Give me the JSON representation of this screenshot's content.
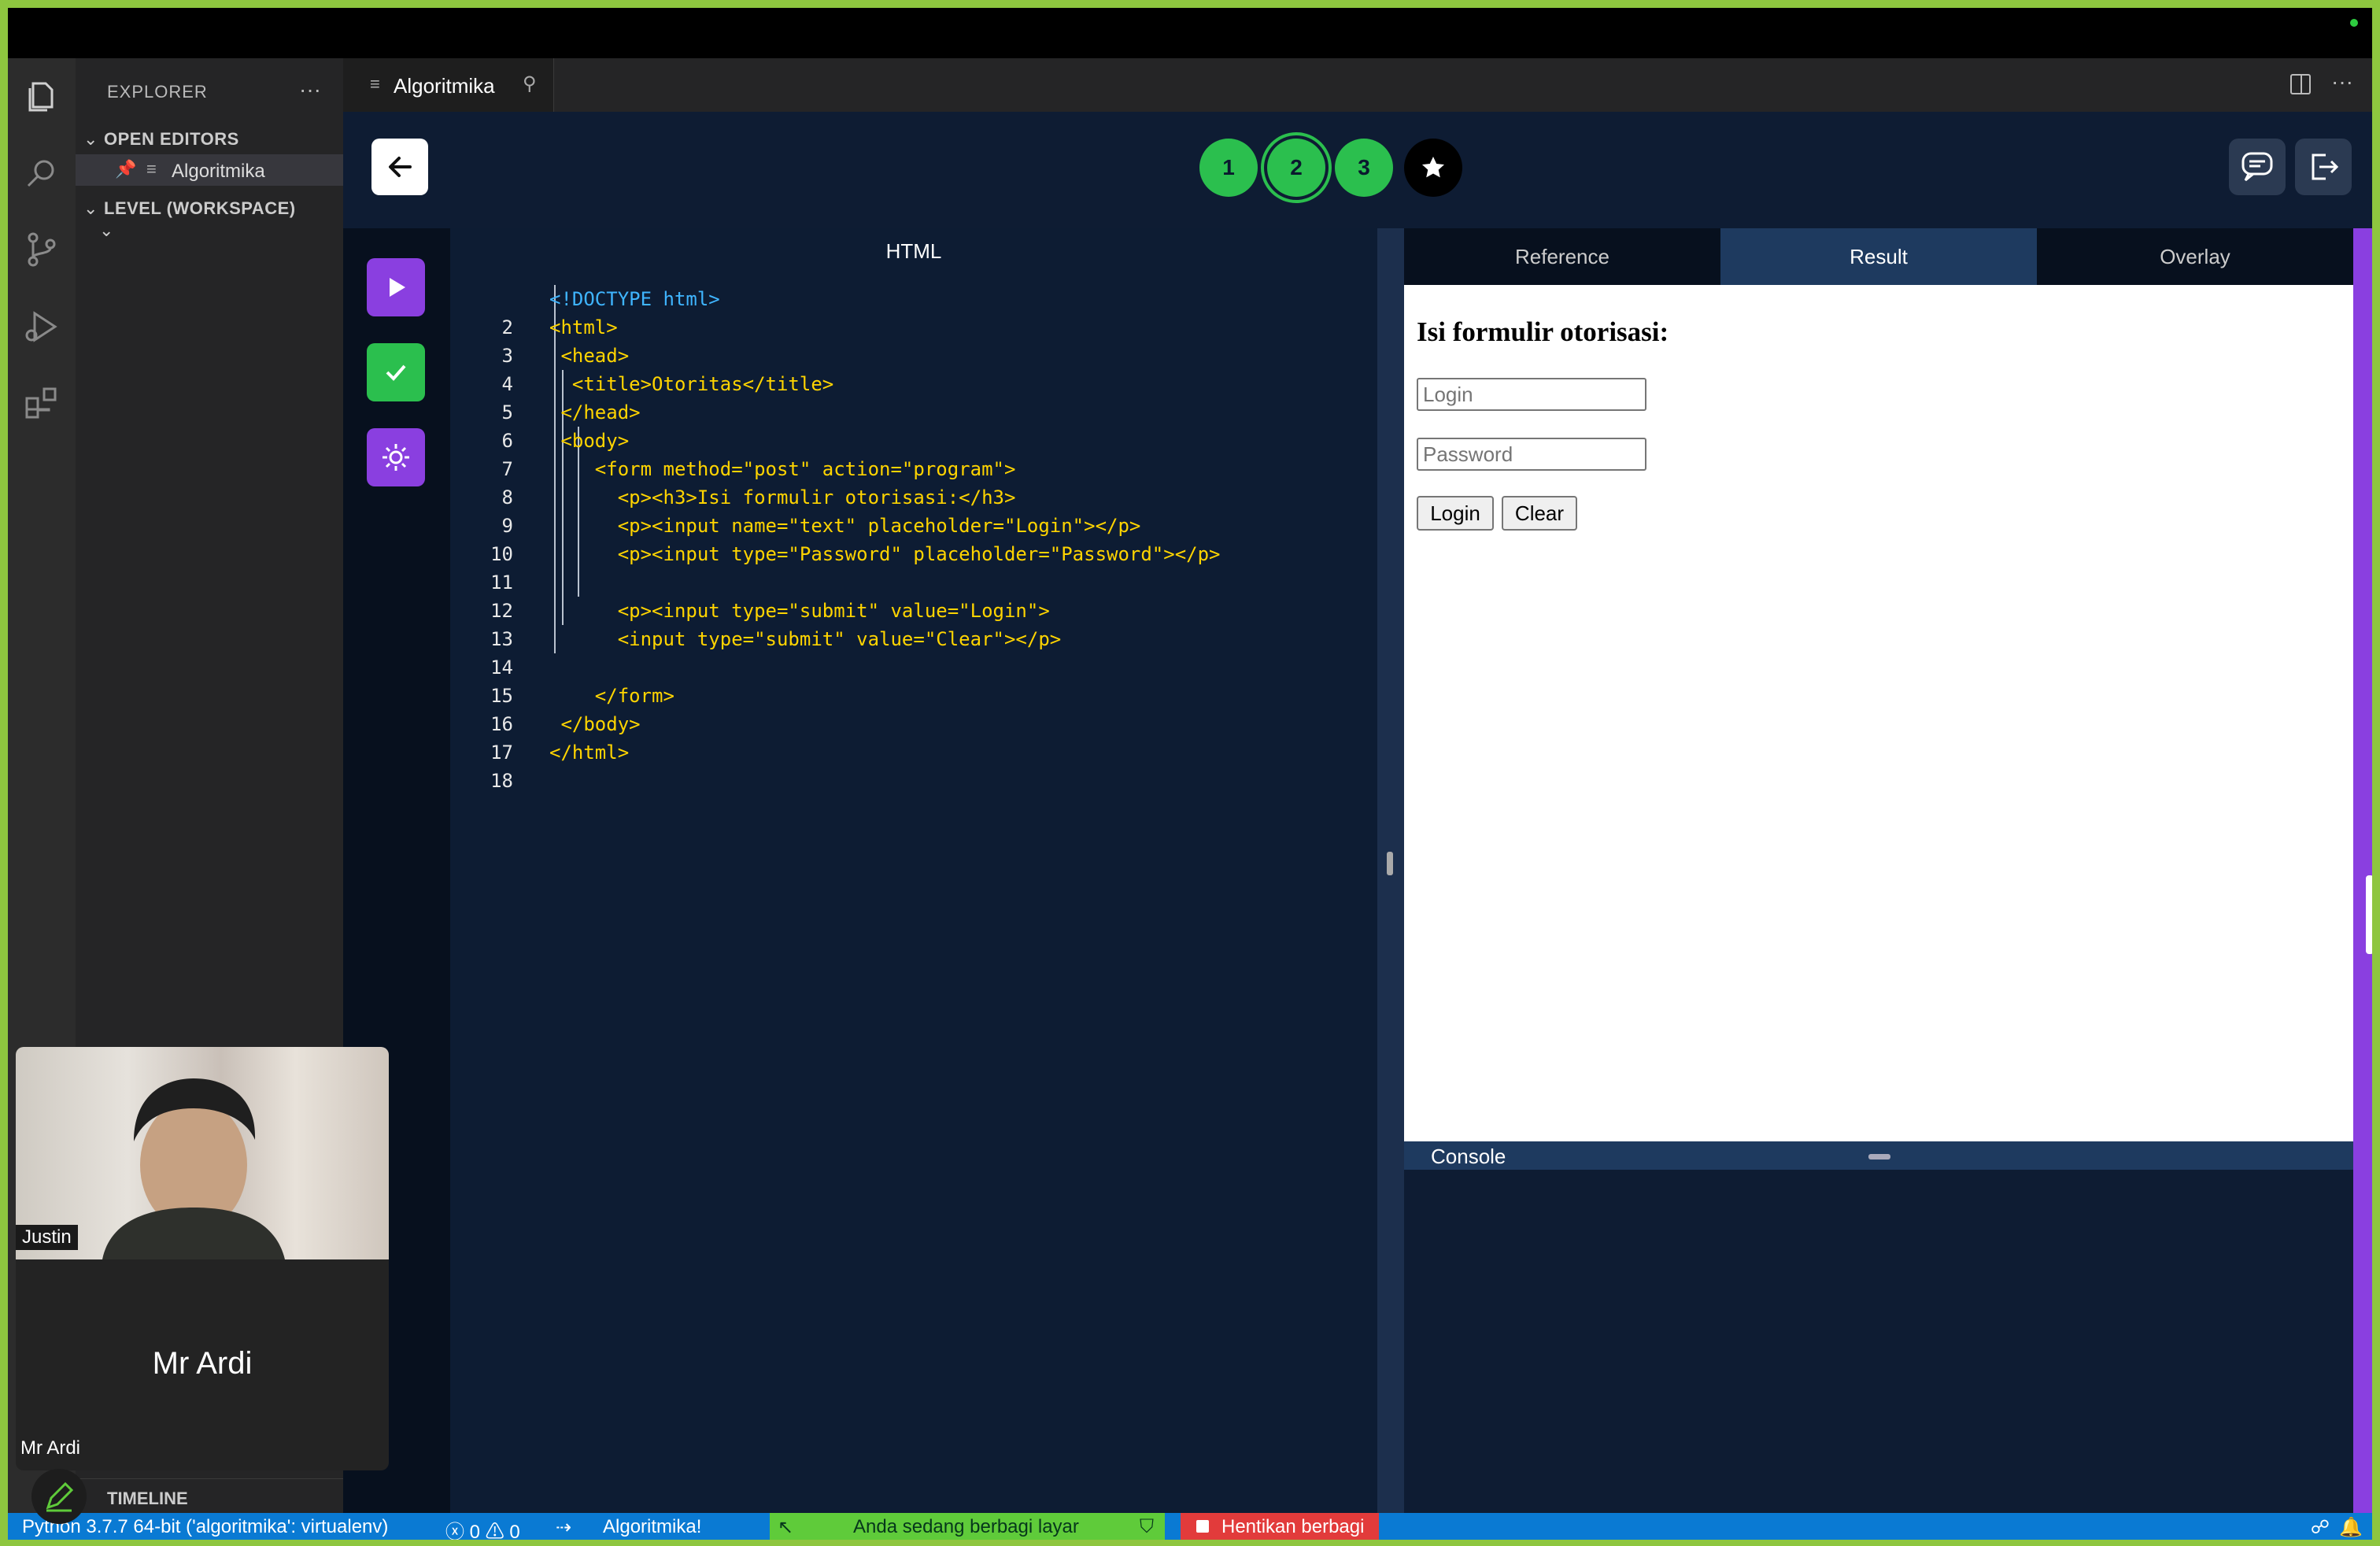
{
  "explorer": {
    "title": "EXPLORER",
    "more": "···",
    "open_editors": "OPEN EDITORS",
    "open_file": "Algoritmika",
    "workspace": "LEVEL (WORKSPACE)",
    "timeline": "TIMELINE"
  },
  "tab": {
    "label": "Algoritmika",
    "more": "···"
  },
  "levels": [
    "1",
    "2",
    "3"
  ],
  "editor": {
    "title": "HTML",
    "line_numbers": [
      "",
      "2",
      "3",
      "4",
      "5",
      "6",
      "7",
      "8",
      "9",
      "10",
      "11",
      "12",
      "13",
      "14",
      "15",
      "16",
      "17",
      "18"
    ],
    "lines": [
      {
        "t": "<!DOCTYPE html>",
        "c": "tg"
      },
      {
        "t": "<html>",
        "c": "br"
      },
      {
        "t": " <head>",
        "c": "br"
      },
      {
        "t": "  <title>Otoritas</title>",
        "c": "br"
      },
      {
        "t": " </head>",
        "c": "br"
      },
      {
        "t": " <body>",
        "c": "br"
      },
      {
        "t": "    <form method=\"post\" action=\"program\">",
        "c": "br"
      },
      {
        "t": "      <p><h3>Isi formulir otorisasi:</h3>",
        "c": "br"
      },
      {
        "t": "      <p><input name=\"text\" placeholder=\"Login\"></p>",
        "c": "br"
      },
      {
        "t": "      <p><input type=\"Password\" placeholder=\"Password\"></p>",
        "c": "br"
      },
      {
        "t": "",
        "c": "tx"
      },
      {
        "t": "      <p><input type=\"submit\" value=\"Login\">",
        "c": "br"
      },
      {
        "t": "      <input type=\"submit\" value=\"Clear\"></p>",
        "c": "br"
      },
      {
        "t": "",
        "c": "tx"
      },
      {
        "t": "    </form>",
        "c": "br"
      },
      {
        "t": " </body>",
        "c": "br"
      },
      {
        "t": "</html>",
        "c": "br"
      },
      {
        "t": "",
        "c": "tx"
      }
    ]
  },
  "preview": {
    "tabs": [
      "Reference",
      "Result",
      "Overlay"
    ],
    "active_tab": "Result",
    "heading": "Isi formulir otorisasi:",
    "login_placeholder": "Login",
    "password_placeholder": "Password",
    "login_button": "Login",
    "clear_button": "Clear",
    "console_label": "Console"
  },
  "video": {
    "participant": "Justin",
    "host_name": "Mr Ardi",
    "host_label": "Mr Ardi"
  },
  "status": {
    "python": "Python 3.7.7 64-bit ('algoritmika': virtualenv)",
    "errors": "0",
    "warnings": "0",
    "app": "Algoritmika!",
    "sharing": "Anda sedang berbagi layar",
    "stop_sharing": "Hentikan berbagi"
  },
  "colors": {
    "level_green": "#2bbf4e",
    "run_purple": "#8a3fe0",
    "check_green": "#2bbf4e",
    "status_blue": "#0a7ad3",
    "share_green": "#5fcb3a",
    "stop_red": "#e23b3b"
  }
}
